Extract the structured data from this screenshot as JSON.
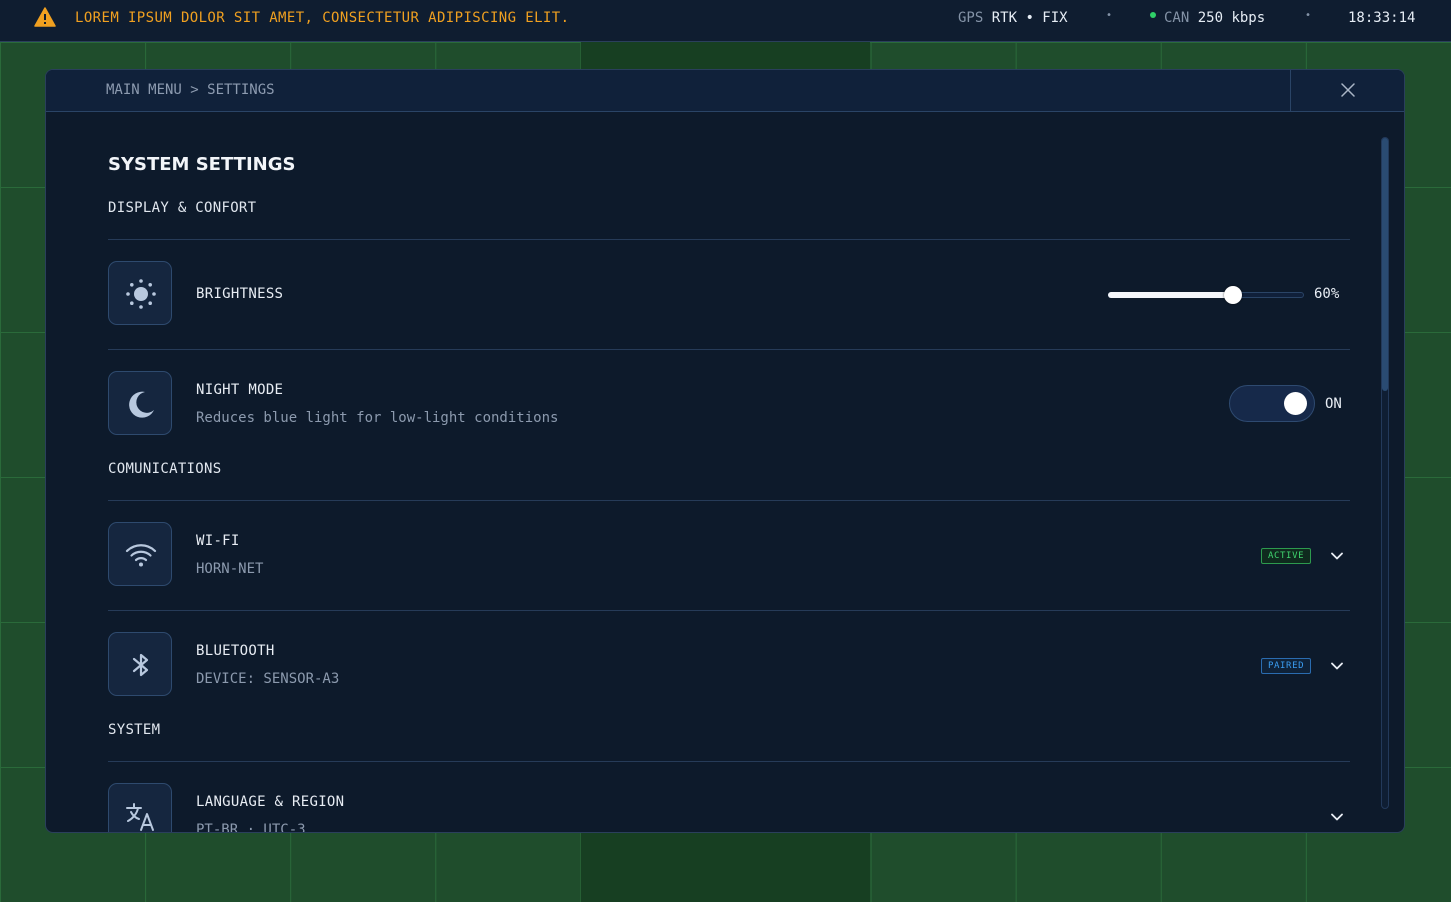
{
  "topbar": {
    "warning": "LOREM IPSUM DOLOR SIT AMET, CONSECTETUR ADIPISCING ELIT.",
    "gps_label": "GPS",
    "gps_value": "RTK • FIX",
    "separator": "•",
    "can_label": "CAN",
    "can_value": "250 kbps",
    "clock": "18:33:14"
  },
  "modal": {
    "breadcrumb": "MAIN MENU > SETTINGS",
    "title": "SYSTEM SETTINGS",
    "sections": {
      "display": "DISPLAY & CONFORT",
      "comms": "COMUNICATIONS",
      "system": "SYSTEM"
    },
    "brightness": {
      "label": "BRIGHTNESS",
      "value": 60,
      "value_text": "60%"
    },
    "night_mode": {
      "label": "NIGHT MODE",
      "description": "Reduces blue light for low-light conditions",
      "state": "ON"
    },
    "wifi": {
      "label": "WI-FI",
      "network": "HORN-NET",
      "badge": "ACTIVE"
    },
    "bluetooth": {
      "label": "BLUETOOTH",
      "device": "DEVICE: SENSOR-A3",
      "badge": "PAIRED"
    },
    "language": {
      "label": "LANGUAGE & REGION",
      "value": "PT-BR · UTC-3"
    },
    "scroll_position": 0
  },
  "colors": {
    "warning": "#f0a020",
    "status_ok": "#2fd068",
    "badge_active": "#3fd46e",
    "badge_paired": "#3a9cf0",
    "panel_bg": "#0d1a2b",
    "map_bg": "#1f4d2c"
  },
  "icons": [
    "warning-icon",
    "close-icon",
    "sun-icon",
    "moon-icon",
    "wifi-icon",
    "bluetooth-icon",
    "translate-icon",
    "chevron-down-icon"
  ]
}
